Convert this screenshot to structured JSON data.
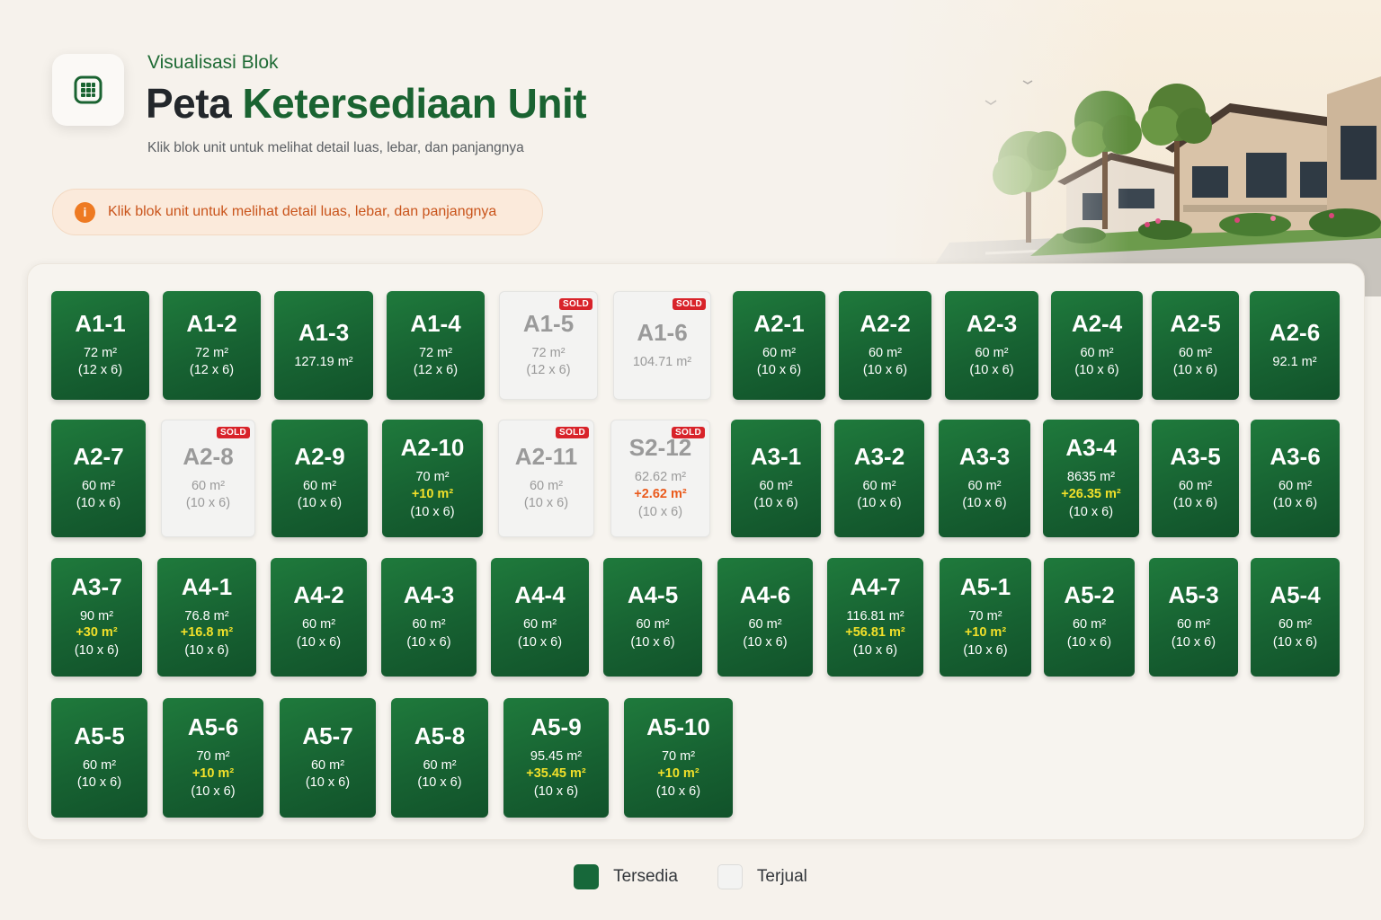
{
  "header": {
    "eyebrow": "Visualisasi Blok",
    "title_prefix": "Peta",
    "title_accent": "Ketersediaan Unit",
    "subtitle": "Klik blok unit untuk melihat detail luas, lebar, dan panjangnya"
  },
  "hint": {
    "icon": "info-icon",
    "icon_glyph": "i",
    "text": "Klik blok unit untuk melihat detail luas, lebar, dan panjangnya"
  },
  "sold_badge": "SOLD",
  "colors": {
    "available": "#17683a",
    "sold": "#f3f3f2",
    "extra_highlight": "#f1e02a",
    "sold_extra": "#ea5a1c",
    "hint_accent": "#ee7a22"
  },
  "legend": {
    "available_label": "Tersedia",
    "sold_label": "Terjual"
  },
  "units": [
    {
      "code": "A1-1",
      "area": "72 m²",
      "dims": "(12 x 6)",
      "status": "available"
    },
    {
      "code": "A1-2",
      "area": "72 m²",
      "dims": "(12 x 6)",
      "status": "available"
    },
    {
      "code": "A1-3",
      "area": "127.19 m²",
      "status": "available"
    },
    {
      "code": "A1-4",
      "area": "72 m²",
      "dims": "(12 x 6)",
      "status": "available"
    },
    {
      "code": "A1-5",
      "area": "72 m²",
      "dims": "(12 x 6)",
      "status": "sold"
    },
    {
      "code": "A1-6",
      "area": "104.71 m²",
      "status": "sold"
    },
    {
      "code": "A2-1",
      "area": "60 m²",
      "dims": "(10 x 6)",
      "status": "available"
    },
    {
      "code": "A2-2",
      "area": "60 m²",
      "dims": "(10 x 6)",
      "status": "available"
    },
    {
      "code": "A2-3",
      "area": "60 m²",
      "dims": "(10 x 6)",
      "status": "available"
    },
    {
      "code": "A2-4",
      "area": "60 m²",
      "dims": "(10 x 6)",
      "status": "available"
    },
    {
      "code": "A2-5",
      "area": "60 m²",
      "dims": "(10 x 6)",
      "status": "available"
    },
    {
      "code": "A2-6",
      "area": "92.1 m²",
      "status": "available"
    },
    {
      "code": "A2-7",
      "area": "60 m²",
      "dims": "(10 x 6)",
      "status": "available"
    },
    {
      "code": "A2-8",
      "area": "60 m²",
      "dims": "(10 x 6)",
      "status": "sold"
    },
    {
      "code": "A2-9",
      "area": "60 m²",
      "dims": "(10 x 6)",
      "status": "available"
    },
    {
      "code": "A2-10",
      "area": "70 m²",
      "extra": "+10 m²",
      "dims": "(10 x 6)",
      "status": "available"
    },
    {
      "code": "A2-11",
      "area": "60 m²",
      "dims": "(10 x 6)",
      "status": "sold"
    },
    {
      "code": "S2-12",
      "area": "62.62 m²",
      "extra": "+2.62 m²",
      "dims": "(10 x 6)",
      "status": "sold"
    },
    {
      "code": "A3-1",
      "area": "60 m²",
      "dims": "(10 x 6)",
      "status": "available"
    },
    {
      "code": "A3-2",
      "area": "60 m²",
      "dims": "(10 x 6)",
      "status": "available"
    },
    {
      "code": "A3-3",
      "area": "60 m²",
      "dims": "(10 x 6)",
      "status": "available"
    },
    {
      "code": "A3-4",
      "area": "8635 m²",
      "extra": "+26.35 m²",
      "dims": "(10 x 6)",
      "status": "available"
    },
    {
      "code": "A3-5",
      "area": "60 m²",
      "dims": "(10 x 6)",
      "status": "available"
    },
    {
      "code": "A3-6",
      "area": "60 m²",
      "dims": "(10 x 6)",
      "status": "available"
    },
    {
      "code": "A3-7",
      "area": "90 m²",
      "extra": "+30 m²",
      "dims": "(10 x 6)",
      "status": "available"
    },
    {
      "code": "A4-1",
      "area": "76.8 m²",
      "extra": "+16.8 m²",
      "dims": "(10 x 6)",
      "status": "available"
    },
    {
      "code": "A4-2",
      "area": "60 m²",
      "dims": "(10 x 6)",
      "status": "available"
    },
    {
      "code": "A4-3",
      "area": "60 m²",
      "dims": "(10 x 6)",
      "status": "available"
    },
    {
      "code": "A4-4",
      "area": "60 m²",
      "dims": "(10 x 6)",
      "status": "available"
    },
    {
      "code": "A4-5",
      "area": "60 m²",
      "dims": "(10 x 6)",
      "status": "available"
    },
    {
      "code": "A4-6",
      "area": "60 m²",
      "dims": "(10 x 6)",
      "status": "available"
    },
    {
      "code": "A4-7",
      "area": "116.81 m²",
      "extra": "+56.81 m²",
      "dims": "(10 x 6)",
      "status": "available"
    },
    {
      "code": "A5-1",
      "area": "70 m²",
      "extra": "+10 m²",
      "dims": "(10 x 6)",
      "status": "available"
    },
    {
      "code": "A5-2",
      "area": "60 m²",
      "dims": "(10 x 6)",
      "status": "available"
    },
    {
      "code": "A5-3",
      "area": "60 m²",
      "dims": "(10 x 6)",
      "status": "available"
    },
    {
      "code": "A5-4",
      "area": "60 m²",
      "dims": "(10 x 6)",
      "status": "available"
    },
    {
      "code": "A5-5",
      "area": "60 m²",
      "dims": "(10 x 6)",
      "status": "available"
    },
    {
      "code": "A5-6",
      "area": "70 m²",
      "extra": "+10 m²",
      "dims": "(10 x 6)",
      "status": "available"
    },
    {
      "code": "A5-7",
      "area": "60 m²",
      "dims": "(10 x 6)",
      "status": "available"
    },
    {
      "code": "A5-8",
      "area": "60 m²",
      "dims": "(10 x 6)",
      "status": "available"
    },
    {
      "code": "A5-9",
      "area": "95.45 m²",
      "extra": "+35.45 m²",
      "dims": "(10 x 6)",
      "status": "available"
    },
    {
      "code": "A5-10",
      "area": "70 m²",
      "extra": "+10 m²",
      "dims": "(10 x 6)",
      "status": "available"
    }
  ]
}
